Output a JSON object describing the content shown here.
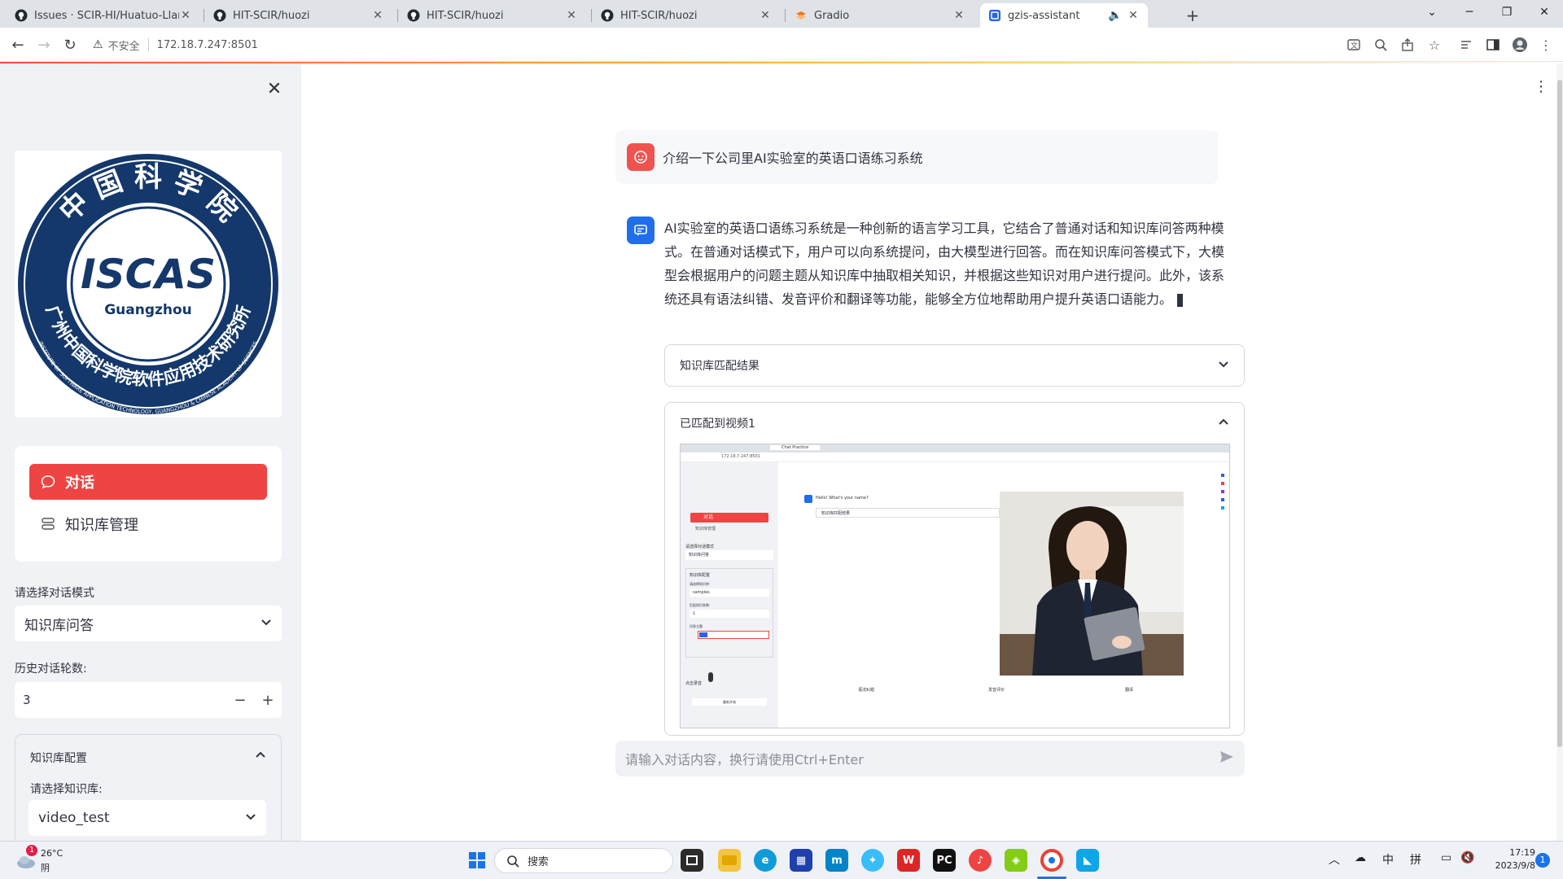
{
  "browser": {
    "tabs": [
      {
        "title": "Issues · SCIR-HI/Huatuo-Llama",
        "icon": "github-icon"
      },
      {
        "title": "HIT-SCIR/huozi",
        "icon": "github-icon"
      },
      {
        "title": "HIT-SCIR/huozi",
        "icon": "github-icon"
      },
      {
        "title": "HIT-SCIR/huozi",
        "icon": "github-icon"
      },
      {
        "title": "Gradio",
        "icon": "gradio-icon"
      },
      {
        "title": "gzis-assistant",
        "icon": "streamlit-icon"
      }
    ],
    "security_label": "不安全",
    "url": "172.18.7.247:8501"
  },
  "sidebar": {
    "logo": {
      "top_arc": "中 国 科 学 院",
      "center": "ISCAS",
      "sub": "Guangzhou",
      "bottom_arc": "广州中国科学院软件应用技术研究所",
      "english_arc": "INSTITUTE OF SOFTWARE APPLICATION TECHNOLOGY, GUANGZHOU & CHINESE ACADEMY OF SCIENCES"
    },
    "menu": [
      {
        "label": "对话",
        "icon": "chat-bubble-icon",
        "active": true
      },
      {
        "label": "知识库管理",
        "icon": "database-icon",
        "active": false
      }
    ],
    "mode_label": "请选择对话模式",
    "mode_value": "知识库问答",
    "history_label": "历史对话轮数:",
    "history_value": "3",
    "kb_config_title": "知识库配置",
    "kb_select_label": "请选择知识库:",
    "kb_select_value": "video_test"
  },
  "chat": {
    "user_message": "介绍一下公司里AI实验室的英语口语练习系统",
    "assistant_message": "AI实验室的英语口语练习系统是一种创新的语言学习工具，它结合了普通对话和知识库问答两种模式。在普通对话模式下，用户可以向系统提问，由大模型进行回答。而在知识库问答模式下，大模型会根据用户的问题主题从知识库中抽取相关知识，并根据这些知识对用户进行提问。此外，该系统还具有语法纠错、发音评价和翻译等功能，能够全方位地帮助用户提升英语口语能力。",
    "expander_1_title": "知识库匹配结果",
    "expander_2_title": "已匹配到视频1",
    "input_placeholder": "请输入对话内容，换行请使用Ctrl+Enter"
  },
  "video_frame": {
    "url": "172.18.7.247:8501",
    "tab_title": "Chat Practice",
    "chat_prompt": "Hello! What's your name?",
    "expander_label": "知识库匹配结果",
    "menu_active": "对话",
    "menu_item": "知识库管理",
    "mode_label": "请选择对话模式",
    "mode_value": "知识库问答",
    "kb_title": "知识库配置",
    "kb_label": "请选择知识库:",
    "kb_value": "samples",
    "match_label": "匹配知识条数:",
    "match_value": "1",
    "topic_label": "问答主题",
    "mic_label": "点击录音",
    "reset_label": "重新开始",
    "btn_grammar": "语法纠错",
    "btn_pronounce": "发音评价",
    "btn_translate": "翻译"
  },
  "taskbar": {
    "weather_temp": "26°C",
    "weather_desc": "阴",
    "weather_badge": "1",
    "search_label": "搜索",
    "ime_lang": "中",
    "ime_mode": "拼",
    "time": "17:19",
    "date": "2023/9/8",
    "notif_badge": "1"
  },
  "colors": {
    "accent": "#ef4444",
    "sidebar_bg": "#f0f2f6",
    "assistant_avatar": "#1f6feb",
    "user_avatar": "#f0534f"
  }
}
